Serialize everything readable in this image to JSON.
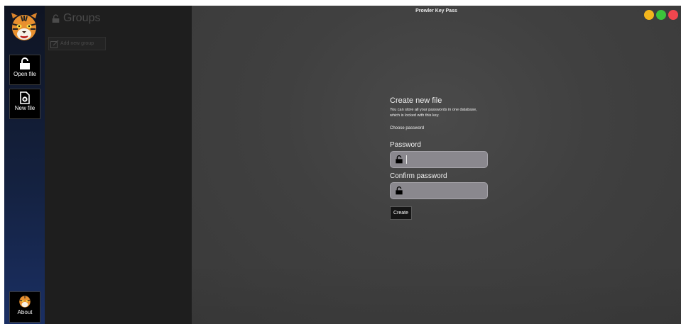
{
  "window": {
    "title": "Prowler Key Pass"
  },
  "sidebar": {
    "open_file": "Open file",
    "new_file": "New file",
    "about": "About"
  },
  "groups": {
    "title": "Groups",
    "add_new_group": "Add new group"
  },
  "form": {
    "title": "Create new file",
    "description": "You can store all your passwords in one database, which is locked with this key.",
    "choose_label": "Choose password",
    "password_label": "Password",
    "password_value": "",
    "confirm_label": "Confirm password",
    "confirm_value": "",
    "create_button": "Create"
  },
  "colors": {
    "minimize": "#f2b51c",
    "maximize": "#3bc43b",
    "close": "#f0464e",
    "rail_gradient_top": "#0f1422",
    "rail_gradient_bottom": "#1a2f63"
  },
  "icons": [
    "tiger-logo-icon",
    "unlock-icon",
    "new-file-icon",
    "lock-icon",
    "add-group-icon",
    "tiger-about-icon"
  ]
}
